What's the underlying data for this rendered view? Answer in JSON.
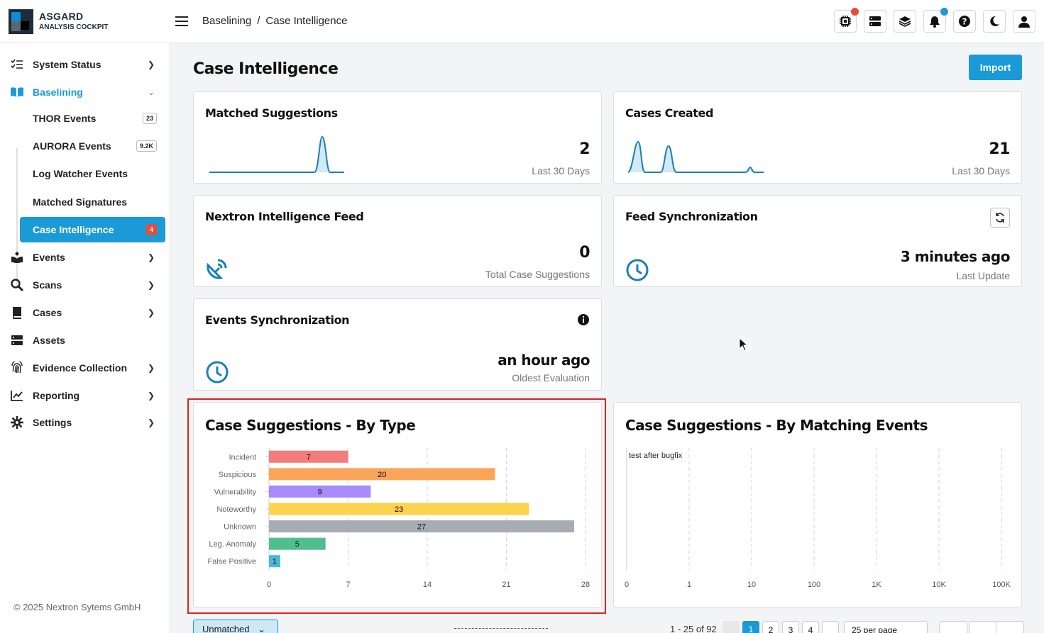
{
  "app": {
    "logo_line1": "ASGARD",
    "logo_line2": "ANALYSIS COCKPIT"
  },
  "breadcrumb": [
    "Baselining",
    "Case Intelligence"
  ],
  "topbar_icons": [
    "chip-icon",
    "server-icon",
    "layers-icon",
    "bell-icon",
    "help-icon",
    "moon-icon",
    "user-icon"
  ],
  "colors": {
    "accent": "#1a9ad6",
    "danger": "#e74c3c",
    "notify": "#1a9ad6"
  },
  "sidebar": {
    "items": [
      {
        "label": "System Status",
        "icon": "list-check-icon"
      },
      {
        "label": "Baselining",
        "icon": "book-open-icon",
        "expanded": true
      },
      {
        "label": "Events",
        "icon": "reader-icon"
      },
      {
        "label": "Scans",
        "icon": "search-icon"
      },
      {
        "label": "Cases",
        "icon": "book-icon"
      },
      {
        "label": "Assets",
        "icon": "server-icon"
      },
      {
        "label": "Evidence Collection",
        "icon": "fingerprint-icon"
      },
      {
        "label": "Reporting",
        "icon": "chart-line-icon"
      },
      {
        "label": "Settings",
        "icon": "gear-icon"
      }
    ],
    "baselining_sub": [
      {
        "label": "THOR Events",
        "badge": "23"
      },
      {
        "label": "AURORA Events",
        "badge": "9.2K"
      },
      {
        "label": "Log Watcher Events",
        "badge": ""
      },
      {
        "label": "Matched Signatures",
        "badge": ""
      },
      {
        "label": "Case Intelligence",
        "badge": "4",
        "active": true
      }
    ],
    "copyright": "© 2025 Nextron Sytems GmbH"
  },
  "page": {
    "title": "Case Intelligence",
    "import_label": "Import"
  },
  "cards": {
    "matched": {
      "title": "Matched Suggestions",
      "value": "2",
      "sub": "Last 30 Days"
    },
    "cases": {
      "title": "Cases Created",
      "value": "21",
      "sub": "Last 30 Days"
    },
    "feed": {
      "title": "Nextron Intelligence Feed",
      "value": "0",
      "sub": "Total Case Suggestions"
    },
    "sync": {
      "title": "Feed Synchronization",
      "value": "3 minutes ago",
      "sub": "Last Update"
    },
    "events_sync": {
      "title": "Events Synchronization",
      "value": "an hour ago",
      "sub": "Oldest Evaluation"
    }
  },
  "chart_data": [
    {
      "type": "bar",
      "orientation": "horizontal",
      "title": "Case Suggestions - By Type",
      "categories": [
        "Incident",
        "Suspicious",
        "Vulnerability",
        "Noteworthy",
        "Unknown",
        "Leg. Anomaly",
        "False Positive"
      ],
      "values": [
        7,
        20,
        9,
        23,
        27,
        5,
        1
      ],
      "bar_colors": [
        "#f47c7c",
        "#fba55a",
        "#a78bfa",
        "#fcd34d",
        "#a7abb3",
        "#4fc08d",
        "#4bb8d4"
      ],
      "xlim": [
        0,
        28
      ],
      "xticks": [
        "0",
        "7",
        "14",
        "21",
        "28"
      ],
      "grid": "vertical-dashed"
    },
    {
      "type": "bar",
      "orientation": "horizontal",
      "title": "Case Suggestions - By Matching Events",
      "categories": [
        "test after bugfix"
      ],
      "values": [
        0
      ],
      "xscale": "log",
      "xticks": [
        "0",
        "1",
        "10",
        "100",
        "1K",
        "10K",
        "100K"
      ],
      "grid": "vertical-dashed"
    }
  ],
  "bottom": {
    "filter": "Unmatched",
    "range": "1 - 25 of 92",
    "pages": [
      "1",
      "2",
      "3",
      "4"
    ],
    "per_page": "25 per page"
  }
}
